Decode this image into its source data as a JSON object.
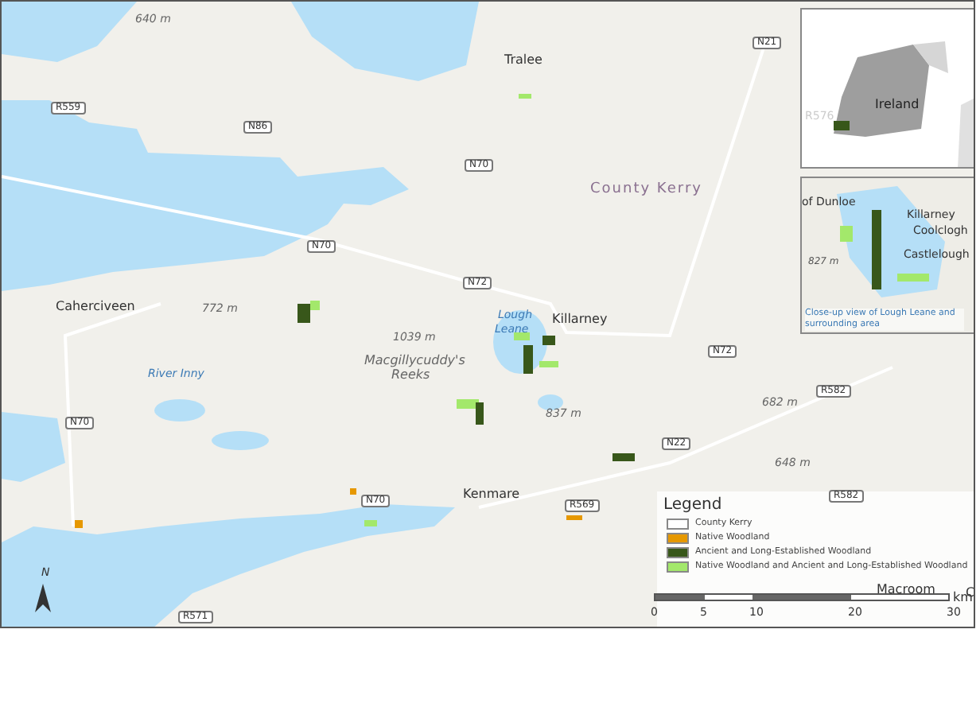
{
  "map": {
    "places": [
      {
        "text": "Tralee",
        "kind": "town"
      },
      {
        "text": "County Kerry",
        "kind": "region"
      },
      {
        "text": "Killarney",
        "kind": "town"
      },
      {
        "text": "Caherciveen",
        "kind": "town"
      },
      {
        "text": "Macgillycuddy's",
        "kind": "range"
      },
      {
        "text": "Reeks",
        "kind": "range"
      },
      {
        "text": "Kenmare",
        "kind": "town"
      },
      {
        "text": "Macroom",
        "kind": "town"
      },
      {
        "text": "Lough",
        "kind": "water"
      },
      {
        "text": "Leane",
        "kind": "water"
      },
      {
        "text": "River Inny",
        "kind": "water"
      },
      {
        "text": "640 m",
        "kind": "peak"
      },
      {
        "text": "772 m",
        "kind": "peak"
      },
      {
        "text": "1039 m",
        "kind": "peak"
      },
      {
        "text": "837 m",
        "kind": "peak"
      },
      {
        "text": "682 m",
        "kind": "peak"
      },
      {
        "text": "648 m",
        "kind": "peak"
      },
      {
        "text": "C",
        "kind": "town"
      }
    ],
    "roads": [
      "R559",
      "N86",
      "N70",
      "N70",
      "N72",
      "N21",
      "N70",
      "N70",
      "R571",
      "N72",
      "R582",
      "N22",
      "R582",
      "R569"
    ],
    "overview_inset": {
      "label": "Ireland",
      "road": "R576"
    },
    "closeup_inset": {
      "labels": [
        "of Dunloe",
        "Killarney",
        "Coolclogh",
        "Castlelough",
        "827 m"
      ],
      "caption": "Close-up view of Lough Leane and surrounding area"
    },
    "legend": {
      "title": "Legend",
      "items": [
        {
          "label": "County Kerry",
          "color": "#ffffff"
        },
        {
          "label": "Native Woodland",
          "color": "#e69800"
        },
        {
          "label": "Ancient and Long-Established Woodland",
          "color": "#38571a"
        },
        {
          "label": "Native Woodland and Ancient and Long-Established Woodland",
          "color": "#a3e86b"
        }
      ]
    },
    "scale_bar": {
      "labels": [
        "0",
        "5",
        "10",
        "20",
        "30"
      ],
      "unit": "km"
    },
    "north_arrow": {
      "label": "N"
    }
  }
}
